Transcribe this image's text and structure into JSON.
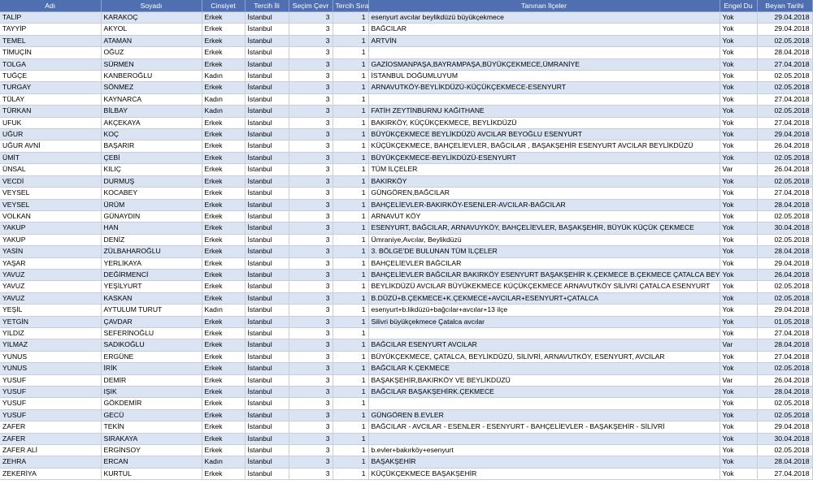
{
  "colors": {
    "header_bg": "#4f6fb0",
    "header_text": "#ffffff",
    "band_row": "#dbe4f2",
    "plain_row": "#ffffff",
    "grid_line": "#c8cdd8"
  },
  "table": {
    "headers": [
      "Adı",
      "Soyadı",
      "Cinsiyet",
      "Tercih İli",
      "Seçim Çevr",
      "Tercih Sıra",
      "Tanınan İlçeler",
      "Engel Du",
      "Beyan Tarihi"
    ],
    "rows": [
      [
        "TALİP",
        "KARAKOÇ",
        "Erkek",
        "İstanbul",
        "3",
        "1",
        "esenyurt avcılar beylikdüzü büyükçekmece",
        "Yok",
        "29.04.2018"
      ],
      [
        "TAYYİP",
        "AKYOL",
        "Erkek",
        "İstanbul",
        "3",
        "1",
        "BAĞCILAR",
        "Yok",
        "29.04.2018"
      ],
      [
        "TEMEL",
        "ATAMAN",
        "Erkek",
        "İstanbul",
        "3",
        "1",
        "ARTVİN",
        "Yok",
        "02.05.2018"
      ],
      [
        "TİMUÇİN",
        "OĞUZ",
        "Erkek",
        "İstanbul",
        "3",
        "1",
        "",
        "Yok",
        "28.04.2018"
      ],
      [
        "TOLGA",
        "SÜRMEN",
        "Erkek",
        "İstanbul",
        "3",
        "1",
        "GAZİOSMANPAŞA,BAYRAMPAŞA,BÜYÜKÇEKMECE,ÜMRANİYE",
        "Yok",
        "27.04.2018"
      ],
      [
        "TUĞÇE",
        "KANBEROĞLU",
        "Kadın",
        "İstanbul",
        "3",
        "1",
        "İSTANBUL DOĞUMLUYUM",
        "Yok",
        "02.05.2018"
      ],
      [
        "TURGAY",
        "SÖNMEZ",
        "Erkek",
        "İstanbul",
        "3",
        "1",
        "ARNAVUTKÖY-BEYLİKDÜZÜ-KÜÇÜKÇEKMECE-ESENYURT",
        "Yok",
        "02.05.2018"
      ],
      [
        "TÜLAY",
        "KAYNARCA",
        "Kadın",
        "İstanbul",
        "3",
        "1",
        "",
        "Yok",
        "27.04.2018"
      ],
      [
        "TÜRKAN",
        "BİLBAY",
        "Kadın",
        "İstanbul",
        "3",
        "1",
        "FATİH ZEYTİNBURNU KAĞITHANE",
        "Yok",
        "02.05.2018"
      ],
      [
        "UFUK",
        "AKÇEKAYA",
        "Erkek",
        "İstanbul",
        "3",
        "1",
        "BAKIRKÖY, KÜÇÜKÇEKMECE, BEYLİKDÜZÜ",
        "Yok",
        "27.04.2018"
      ],
      [
        "UĞUR",
        "KOÇ",
        "Erkek",
        "İstanbul",
        "3",
        "1",
        "BÜYÜKÇEKMECE BEYLİKDÜZÜ AVCILAR BEYOĞLU ESENYURT",
        "Yok",
        "29.04.2018"
      ],
      [
        "UĞUR AVNİ",
        "BAŞARIR",
        "Erkek",
        "İstanbul",
        "3",
        "1",
        "KÜÇÜKÇEKMECE, BAHÇELİEVLER, BAĞCILAR , BAŞAKŞEHİR ESENYURT AVCILAR BEYLİKDÜZÜ",
        "Yok",
        "26.04.2018"
      ],
      [
        "ÜMİT",
        "ÇEBİ",
        "Erkek",
        "İstanbul",
        "3",
        "1",
        "BÜYÜKÇEKMECE-BEYLİKDÜZÜ-ESENYURT",
        "Yok",
        "02.05.2018"
      ],
      [
        "ÜNSAL",
        "KILIÇ",
        "Erkek",
        "İstanbul",
        "3",
        "1",
        "TÜM İLÇELER",
        "Var",
        "26.04.2018"
      ],
      [
        "VECDİ",
        "DURMUŞ",
        "Erkek",
        "İstanbul",
        "3",
        "1",
        "BAKIRKÖY",
        "Yok",
        "02.05.2018"
      ],
      [
        "VEYSEL",
        "KOCABEY",
        "Erkek",
        "İstanbul",
        "3",
        "1",
        "GÜNGÖREN,BAĞCILAR",
        "Yok",
        "27.04.2018"
      ],
      [
        "VEYSEL",
        "ÜRÜM",
        "Erkek",
        "İstanbul",
        "3",
        "1",
        "BAHÇELİEVLER-BAKIRKÖY-ESENLER-AVCILAR-BAĞCILAR",
        "Yok",
        "28.04.2018"
      ],
      [
        "VOLKAN",
        "GÜNAYDIN",
        "Erkek",
        "İstanbul",
        "3",
        "1",
        "ARNAVUT KÖY",
        "Yok",
        "02.05.2018"
      ],
      [
        "YAKUP",
        "HAN",
        "Erkek",
        "İstanbul",
        "3",
        "1",
        "ESENYURT, BAĞCILAR, ARNAVUYKÖY, BAHÇELİEVLER, BAŞAKŞEHİR, BÜYÜK KÜÇÜK ÇEKMECE",
        "Yok",
        "30.04.2018"
      ],
      [
        "YAKUP",
        "DENİZ",
        "Erkek",
        "İstanbul",
        "3",
        "1",
        "Ümraniye,Avcılar, Beylikdüzü",
        "Yok",
        "02.05.2018"
      ],
      [
        "YASİN",
        "ZÜLBAHAROĞLU",
        "Erkek",
        "İstanbul",
        "3",
        "1",
        "3. BÖLGE'DE BULUNAN TÜM İLÇELER",
        "Yok",
        "28.04.2018"
      ],
      [
        "YAŞAR",
        "YERLİKAYA",
        "Erkek",
        "İstanbul",
        "3",
        "1",
        "BAHÇELİEVLER  BAĞCILAR",
        "Yok",
        "29.04.2018"
      ],
      [
        "YAVUZ",
        "DEĞİRMENCİ",
        "Erkek",
        "İstanbul",
        "3",
        "1",
        "BAHÇELİEVLER BAĞCILAR BAKIRKÖY ESENYURT BAŞAKŞEHİR K.ÇEKMECE B.ÇEKMECE ÇATALCA BEYL",
        "Yok",
        "26.04.2018"
      ],
      [
        "YAVUZ",
        "YEŞİLYURT",
        "Erkek",
        "İstanbul",
        "3",
        "1",
        "BEYLİKDÜZÜ AVCILAR BÜYÜKEKMECE KÜÇÜKÇEKMECE ARNAVUTKÖY SİLİVRİ ÇATALCA ESENYURT",
        "Yok",
        "02.05.2018"
      ],
      [
        "YAVUZ",
        "KASKAN",
        "Erkek",
        "İstanbul",
        "3",
        "1",
        "B.DÜZÜ+B.ÇEKMECE+K.ÇEKMECE+AVCILAR+ESENYURT+ÇATALCA",
        "Yok",
        "02.05.2018"
      ],
      [
        "YEŞİL",
        "AYTULUM TURUT",
        "Kadın",
        "İstanbul",
        "3",
        "1",
        "esenyurt+b.likdüzü+bağcılar+avcılar+13 ilçe",
        "Yok",
        "29.04.2018"
      ],
      [
        "YETGİN",
        "ÇAVDAR",
        "Erkek",
        "İstanbul",
        "3",
        "1",
        "Silivri büyükçekmece Çatalca avcılar",
        "Yok",
        "01.05.2018"
      ],
      [
        "YILDIZ",
        "SEFERİNOĞLU",
        "Erkek",
        "İstanbul",
        "3",
        "1",
        "",
        "Yok",
        "27.04.2018"
      ],
      [
        "YILMAZ",
        "SADIKOĞLU",
        "Erkek",
        "İstanbul",
        "3",
        "1",
        "BAĞCILAR ESENYURT AVCILAR",
        "Var",
        "28.04.2018"
      ],
      [
        "YUNUS",
        "ERGÜNE",
        "Erkek",
        "İstanbul",
        "3",
        "1",
        "BÜYÜKÇEKMECE, ÇATALCA, BEYLİKDÜZÜ, SİLİVRİ, ARNAVUTKÖY, ESENYURT, AVCILAR",
        "Yok",
        "27.04.2018"
      ],
      [
        "YUNUS",
        "İRİK",
        "Erkek",
        "İstanbul",
        "3",
        "1",
        "BAĞCILAR K.ÇEKMECE",
        "Yok",
        "02.05.2018"
      ],
      [
        "YUSUF",
        "DEMİR",
        "Erkek",
        "İstanbul",
        "3",
        "1",
        "BAŞAKŞEHİR,BAKIRKÖY VE BEYLİKDÜZÜ",
        "Var",
        "26.04.2018"
      ],
      [
        "YUSUF",
        "IŞIK",
        "Erkek",
        "İstanbul",
        "3",
        "1",
        "BAĞCILAR BAŞAKŞEHİRK.ÇEKMECE",
        "Yok",
        "28.04.2018"
      ],
      [
        "YUSUF",
        "GÖKDEMİR",
        "Erkek",
        "İstanbul",
        "3",
        "1",
        "",
        "Yok",
        "02.05.2018"
      ],
      [
        "YUSUF",
        "GECÜ",
        "Erkek",
        "İstanbul",
        "3",
        "1",
        "GÜNGÖREN B.EVLER",
        "Yok",
        "02.05.2018"
      ],
      [
        "ZAFER",
        "TEKİN",
        "Erkek",
        "İstanbul",
        "3",
        "1",
        "BAĞCILAR - AVCILAR - ESENLER - ESENYURT - BAHÇELİEVLER - BAŞAKŞEHİR - SİLİVRİ",
        "Yok",
        "29.04.2018"
      ],
      [
        "ZAFER",
        "SIRAKAYA",
        "Erkek",
        "İstanbul",
        "3",
        "1",
        "",
        "Yok",
        "30.04.2018"
      ],
      [
        "ZAFER ALİ",
        "ERGİNSOY",
        "Erkek",
        "İstanbul",
        "3",
        "1",
        "b.evler+bakırköy+esenyurt",
        "Yok",
        "02.05.2018"
      ],
      [
        "ZEHRA",
        "ERCAN",
        "Kadın",
        "İstanbul",
        "3",
        "1",
        "BAŞAKŞEHİR",
        "Yok",
        "28.04.2018"
      ],
      [
        "ZEKERİYA",
        "KURTUL",
        "Erkek",
        "İstanbul",
        "3",
        "1",
        "KÜÇÜKÇEKMECE BAŞAKŞEHİR",
        "Yok",
        "27.04.2018"
      ]
    ]
  }
}
